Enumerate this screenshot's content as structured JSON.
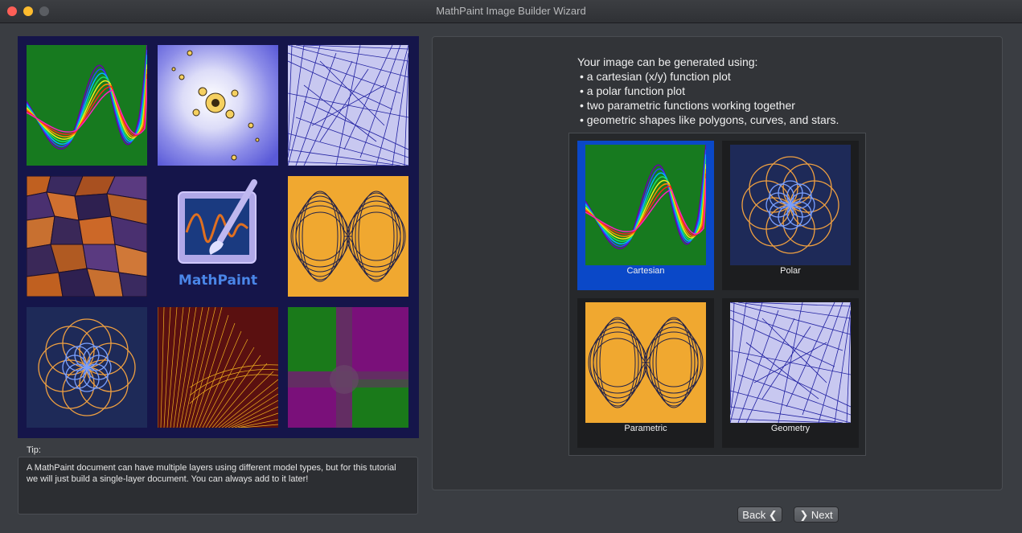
{
  "window": {
    "title": "MathPaint Image Builder Wizard"
  },
  "gallery": {
    "logo_text": "MathPaint",
    "tiles": [
      "cartesian-rainbow-wave",
      "julia-fractal",
      "geometry-spiral",
      "voronoi-pattern",
      "mathpaint-logo",
      "parametric-loops",
      "polar-rose",
      "moire-lines",
      "quadrant-gradient"
    ]
  },
  "tip": {
    "label": "Tip:",
    "text": "A MathPaint document can have multiple layers using different model types, but for this tutorial we will just build a single-layer document. You can always add to it later!"
  },
  "intro": {
    "heading": "Your image can be generated using:",
    "bullets": [
      "• a cartesian (x/y) function plot",
      "• a polar function plot",
      "• two parametric functions working together",
      "• geometric shapes like polygons, curves, and stars."
    ]
  },
  "choices": [
    {
      "label": "Cartesian",
      "selected": true
    },
    {
      "label": "Polar",
      "selected": false
    },
    {
      "label": "Parametric",
      "selected": false
    },
    {
      "label": "Geometry",
      "selected": false
    }
  ],
  "buttons": {
    "back": "Back ❮",
    "next": "❯ Next"
  },
  "colors": {
    "selected": "#0a48c8",
    "gallery_bg": "#15154a",
    "tip_bg": "#2c2e32"
  }
}
